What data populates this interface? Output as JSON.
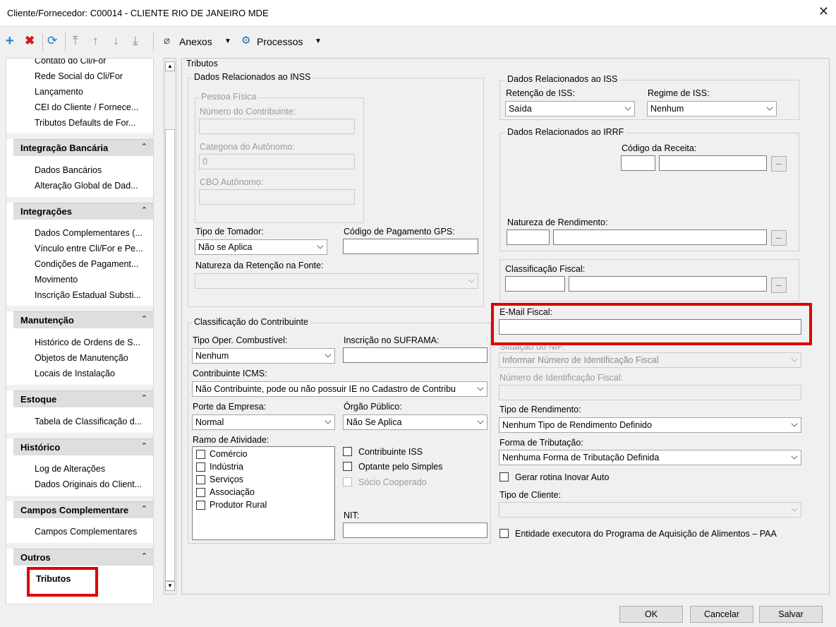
{
  "window": {
    "title": "Cliente/Fornecedor: C00014 - CLIENTE RIO DE JANEIRO MDE"
  },
  "toolbar": {
    "anexos": "Anexos",
    "processos": "Processos"
  },
  "sidebar": {
    "top_items": [
      "Contato do Cli/For",
      "Rede Social do Cli/For",
      "Lançamento",
      "CEI do Cliente / Fornece...",
      "Tributos Defaults de For..."
    ],
    "groups": [
      {
        "title": "Integração Bancária",
        "items": [
          "Dados Bancários",
          "Alteração Global de Dad..."
        ]
      },
      {
        "title": "Integrações",
        "items": [
          "Dados Complementares (...",
          "Vínculo entre Cli/For e Pe...",
          "Condições de Pagament...",
          "Movimento",
          "Inscrição Estadual Substi..."
        ]
      },
      {
        "title": "Manutenção",
        "items": [
          "Histórico de Ordens de S...",
          "Objetos de Manutenção",
          "Locais de Instalação"
        ]
      },
      {
        "title": "Estoque",
        "items": [
          "Tabela de Classificação d..."
        ]
      },
      {
        "title": "Histórico",
        "items": [
          "Log de Alterações",
          "Dados Originais do Client..."
        ]
      },
      {
        "title": "Campos Complementare",
        "items": [
          "Campos Complementares"
        ]
      },
      {
        "title": "Outros",
        "items": [
          "Tributos"
        ]
      }
    ]
  },
  "tributos": {
    "title": "Tributos",
    "inss": {
      "title": "Dados Relacionados ao INSS",
      "pf_title": "Pessoa Física",
      "num_contrib": "Número do Contribuinte:",
      "categoria": "Categoria do Autônomo:",
      "categoria_value": "0",
      "cbo": "CBO Autônomo:",
      "tipo_tomador": "Tipo de Tomador:",
      "tipo_tomador_value": "Não se Aplica",
      "cod_gps": "Código de Pagamento GPS:",
      "natureza_ret": "Natureza da Retenção na Fonte:"
    },
    "classif": {
      "title": "Classificação do Contribuinte",
      "tipo_oper": "Tipo Oper. Combustível:",
      "tipo_oper_value": "Nenhum",
      "suframa": "Inscrição no SUFRAMA:",
      "icms": "Contribuinte ICMS:",
      "icms_value": "Não Contribuinte, pode ou não possuir IE no Cadastro de Contribu",
      "porte": "Porte da Empresa:",
      "porte_value": "Normal",
      "orgao": "Órgão Público:",
      "orgao_value": "Não Se Aplica",
      "ramo": "Ramo de Atividade:",
      "ramo_items": [
        "Comércio",
        "Indústria",
        "Serviços",
        "Associação",
        "Produtor Rural"
      ],
      "contrib_iss": "Contribuinte ISS",
      "simples": "Optante pelo Simples",
      "socio": "Sócio Cooperado",
      "nit": "NIT:"
    },
    "iss": {
      "title": "Dados Relacionados ao ISS",
      "retencao": "Retenção de ISS:",
      "retencao_value": "Saída",
      "regime": "Regime de ISS:",
      "regime_value": "Nenhum"
    },
    "irrf": {
      "title": "Dados Relacionados ao IRRF",
      "cod_receita": "Código da Receita:",
      "natureza_rend": "Natureza de Rendimento:"
    },
    "classif_fiscal": "Classificação Fiscal:",
    "email_fiscal": "E-Mail Fiscal:",
    "situacao_nif": "Situação do NIF:",
    "situacao_nif_value": "Informar Número de Identificação Fiscal",
    "numero_nif": "Número de Identificação Fiscal:",
    "tipo_rend": "Tipo de Rendimento:",
    "tipo_rend_value": "Nenhum Tipo de Rendimento Definido",
    "forma_trib": "Forma de Tributação:",
    "forma_trib_value": "Nenhuma Forma de Tributação Definida",
    "inovar": "Gerar rotina Inovar Auto",
    "tipo_cliente": "Tipo de Cliente:",
    "paa": "Entidade executora do Programa de Aquisição de Alimentos – PAA"
  },
  "footer": {
    "ok": "OK",
    "cancel": "Cancelar",
    "save": "Salvar"
  },
  "colors": {
    "highlight": "#e00000",
    "add": "#1a7fd1",
    "delete": "#d11a1a"
  }
}
